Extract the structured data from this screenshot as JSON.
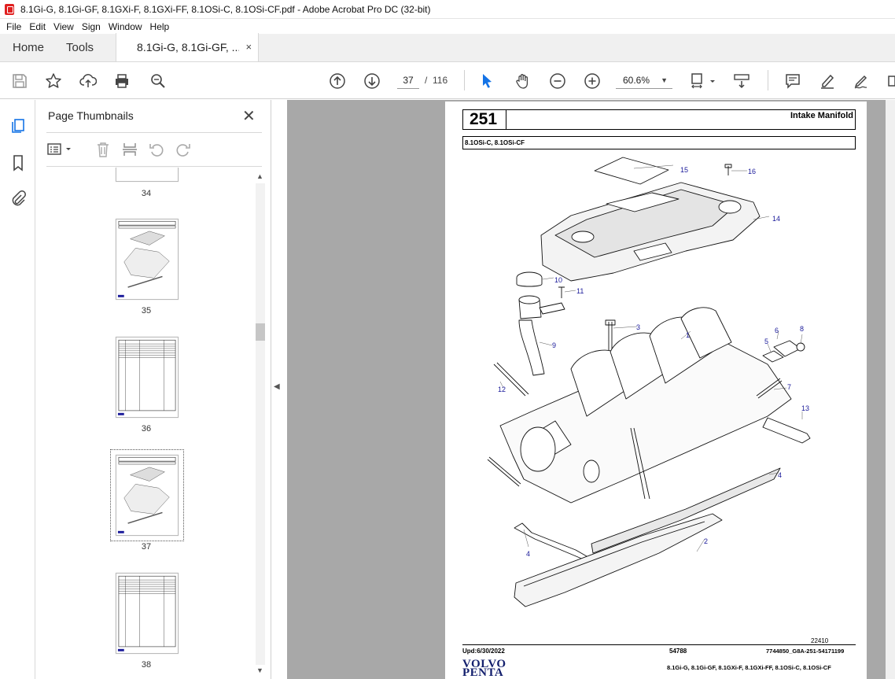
{
  "window": {
    "title": "8.1Gi-G, 8.1Gi-GF, 8.1GXi-F, 8.1GXi-FF, 8.1OSi-C, 8.1OSi-CF.pdf - Adobe Acrobat Pro DC (32-bit)"
  },
  "menu": {
    "items": [
      "File",
      "Edit",
      "View",
      "Sign",
      "Window",
      "Help"
    ]
  },
  "tabs": {
    "home": "Home",
    "tools": "Tools",
    "document": "8.1Gi-G, 8.1Gi-GF, ...",
    "close": "×"
  },
  "toolbar": {
    "current_page": "37",
    "page_separator": "/",
    "total_pages": "116",
    "zoom": "60.6%",
    "icons": [
      "save-icon",
      "star-icon",
      "upload-icon",
      "print-icon",
      "search-zoom-icon",
      "page-up-icon",
      "page-down-icon",
      "select-cursor-icon",
      "hand-icon",
      "zoom-out-icon",
      "zoom-in-icon",
      "fit-page-icon",
      "scroll-mode-icon",
      "comment-icon",
      "highlight-icon",
      "sign-icon",
      "more-icon"
    ]
  },
  "thumbnails_panel": {
    "title": "Page Thumbnails",
    "close": "✕",
    "pages": [
      {
        "number": "34"
      },
      {
        "number": "35"
      },
      {
        "number": "36"
      },
      {
        "number": "37",
        "selected": true
      },
      {
        "number": "38"
      }
    ]
  },
  "document_page": {
    "section_number": "251",
    "section_title": "Intake Manifold",
    "models_header": "8.1OSi-C, 8.1OSi-CF",
    "callouts": [
      "15",
      "16",
      "14",
      "10",
      "11",
      "3",
      "1",
      "6",
      "8",
      "5",
      "9",
      "12",
      "7",
      "13",
      "4",
      "4",
      "2"
    ],
    "drawing_number": "22410",
    "footer": {
      "updated": "Upd:6/30/2022",
      "code": "54788",
      "part_ref": "7744850_G8A-251-54171199",
      "models": "8.1Gi-G, 8.1Gi-GF, 8.1GXi-F, 8.1GXi-FF, 8.1OSi-C, 8.1OSi-CF",
      "brand_top": "VOLVO",
      "brand_bottom": "PENTA"
    }
  },
  "colors": {
    "acrobat_red": "#e02020",
    "accent_blue": "#1473e6",
    "callout_blue": "#1a1a9a",
    "brand_navy": "#14206e"
  }
}
